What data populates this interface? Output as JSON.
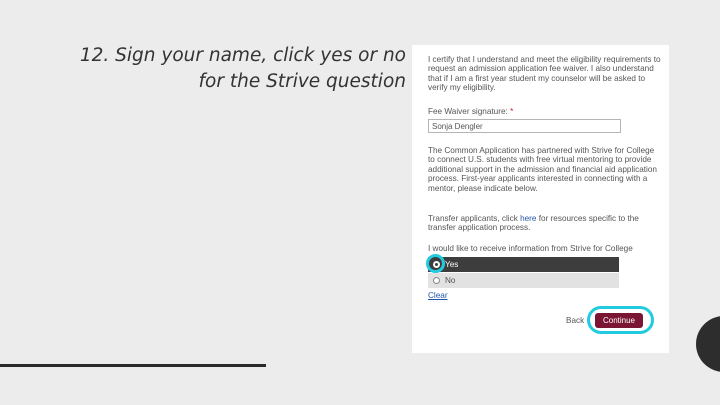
{
  "slide": {
    "title_line1": "12. Sign your name, click yes or no",
    "title_line2": "for the Strive question"
  },
  "form": {
    "certify_text": "I certify that I understand and meet the eligibility requirements to request an admission application fee waiver. I also understand that if I am a first year student my counselor will be asked to verify my eligibility.",
    "signature_label": "Fee Waiver signature:",
    "required_mark": "*",
    "signature_value": "Sonja Dengler",
    "strive_text": "The Common Application has partnered with Strive for College to connect U.S. students with free virtual mentoring to provide additional support in the admission and financial aid application process. First-year applicants interested in connecting with a mentor, please indicate below.",
    "transfer_text_before": "Transfer applicants, click ",
    "transfer_link": "here",
    "transfer_text_after": " for resources specific to the transfer application process.",
    "strive_question": "I would like to receive information from Strive for College",
    "option_yes": "Yes",
    "option_no": "No",
    "clear_label": "Clear",
    "back_label": "Back",
    "continue_label": "Continue"
  },
  "colors": {
    "highlight": "#22cbe0",
    "continue_button": "#7a1534",
    "selected_row": "#3d3d3d"
  }
}
